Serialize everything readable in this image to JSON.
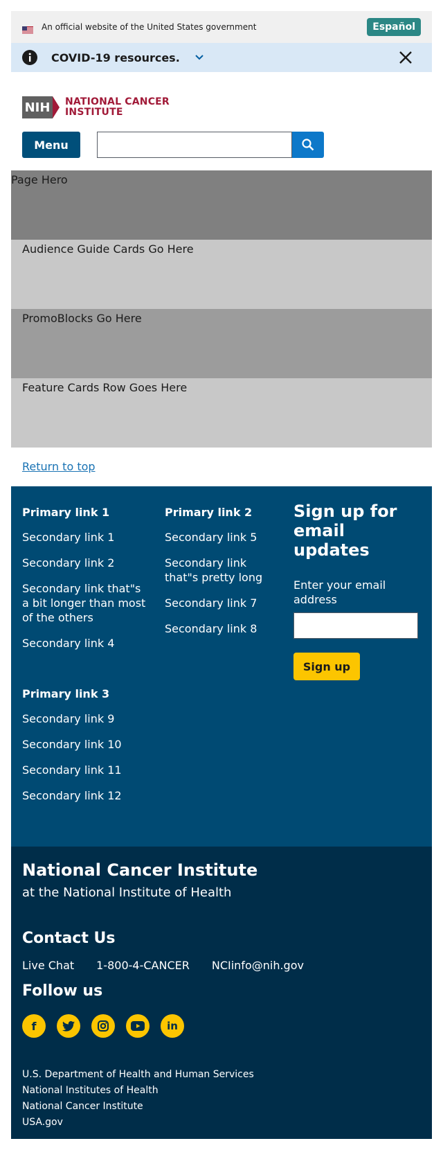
{
  "banner": {
    "text": "An official website of the United States government",
    "lang_button": "Español"
  },
  "covid": {
    "label": "COVID-19 resources."
  },
  "logo": {
    "nih": "NIH",
    "line1": "NATIONAL CANCER",
    "line2": "INSTITUTE"
  },
  "nav": {
    "menu": "Menu",
    "search_placeholder": ""
  },
  "sections": {
    "hero": "Page Hero",
    "audience": "Audience Guide Cards Go Here",
    "promo": "PromoBlocks Go Here",
    "feature": "Feature Cards Row Goes Here"
  },
  "return_top": "Return to top",
  "footer": {
    "col1": {
      "primary": "Primary link 1",
      "links": [
        "Secondary link 1",
        "Secondary link 2",
        "Secondary link that\"s a bit longer than most of the others",
        "Secondary link 4"
      ]
    },
    "col2": {
      "primary": "Primary link 2",
      "links": [
        "Secondary link 5",
        "Secondary link that\"s pretty long",
        "Secondary link 7",
        "Secondary link 8"
      ]
    },
    "col3": {
      "primary": "Primary link 3",
      "links": [
        "Secondary link 9",
        "Secondary link 10",
        "Secondary link 11",
        "Secondary link 12"
      ]
    },
    "signup": {
      "title": "Sign up for email updates",
      "label": "Enter your email address",
      "button": "Sign up"
    }
  },
  "org": {
    "title": "National Cancer Institute",
    "sub": "at the National Institute of Health"
  },
  "contact": {
    "title": "Contact Us",
    "items": [
      "Live Chat",
      "1-800-4-CANCER",
      "NCIinfo@nih.gov"
    ]
  },
  "follow": {
    "title": "Follow us",
    "icons": [
      "facebook-icon",
      "twitter-icon",
      "instagram-icon",
      "youtube-icon",
      "linkedin-icon"
    ]
  },
  "legal": [
    "U.S. Department of Health and Human Services",
    "National Institutes of Health",
    "National Cancer Institute",
    "USA.gov"
  ],
  "colors": {
    "primary": "#004a73",
    "accent": "#fcc500",
    "dark": "#002d49",
    "brand_red": "#a11a38"
  }
}
